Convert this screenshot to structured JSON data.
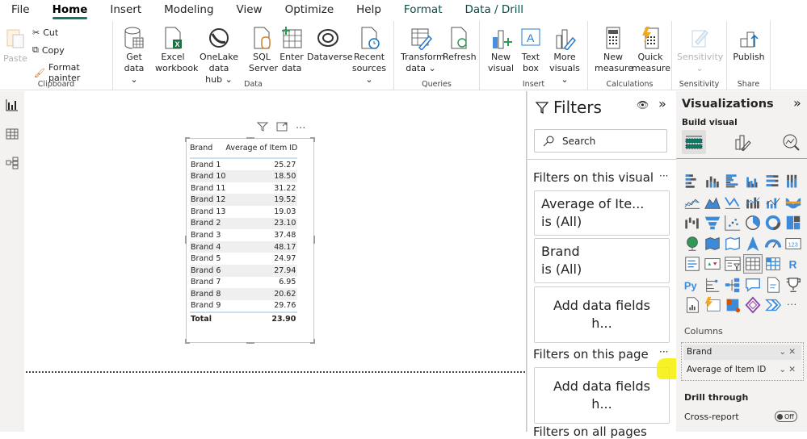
{
  "menu": {
    "tabs": [
      {
        "label": "File"
      },
      {
        "label": "Home",
        "active": true
      },
      {
        "label": "Insert"
      },
      {
        "label": "Modeling"
      },
      {
        "label": "View"
      },
      {
        "label": "Optimize"
      },
      {
        "label": "Help"
      },
      {
        "label": "Format",
        "contextual": true
      },
      {
        "label": "Data / Drill",
        "contextual": true
      }
    ]
  },
  "ribbon": {
    "clipboard": {
      "label": "Clipboard",
      "paste": "Paste",
      "cut": "Cut",
      "copy": "Copy",
      "format_painter": "Format painter"
    },
    "data": {
      "label": "Data",
      "get_data": [
        "Get",
        "data ⌄"
      ],
      "excel": [
        "Excel",
        "workbook"
      ],
      "onelake": [
        "OneLake data",
        "hub ⌄"
      ],
      "sql": [
        "SQL",
        "Server"
      ],
      "enter": [
        "Enter",
        "data"
      ],
      "dataverse": [
        "Dataverse",
        ""
      ],
      "recent": [
        "Recent",
        "sources ⌄"
      ]
    },
    "queries": {
      "label": "Queries",
      "transform": [
        "Transform",
        "data ⌄"
      ],
      "refresh": [
        "Refresh",
        ""
      ]
    },
    "insert": {
      "label": "Insert",
      "new_visual": [
        "New",
        "visual"
      ],
      "text_box": [
        "Text",
        "box"
      ],
      "more_visuals": [
        "More",
        "visuals ⌄"
      ]
    },
    "calculations": {
      "label": "Calculations",
      "new_measure": [
        "New",
        "measure"
      ],
      "quick_measure": [
        "Quick",
        "measure"
      ]
    },
    "sensitivity": {
      "label": "Sensitivity",
      "btn": [
        "Sensitivity",
        "⌄"
      ]
    },
    "share": {
      "label": "Share",
      "publish": [
        "Publish",
        ""
      ]
    }
  },
  "visual": {
    "headers": [
      "Brand",
      "Average of Item ID"
    ],
    "rows": [
      [
        "Brand 1",
        "25.27"
      ],
      [
        "Brand 10",
        "18.50"
      ],
      [
        "Brand 11",
        "31.22"
      ],
      [
        "Brand 12",
        "19.52"
      ],
      [
        "Brand 13",
        "19.03"
      ],
      [
        "Brand 2",
        "23.10"
      ],
      [
        "Brand 3",
        "37.48"
      ],
      [
        "Brand 4",
        "48.17"
      ],
      [
        "Brand 5",
        "24.97"
      ],
      [
        "Brand 6",
        "27.94"
      ],
      [
        "Brand 7",
        "6.95"
      ],
      [
        "Brand 8",
        "20.62"
      ],
      [
        "Brand 9",
        "29.76"
      ]
    ],
    "total": [
      "Total",
      "23.90"
    ]
  },
  "filters": {
    "title": "Filters",
    "search_placeholder": "Search",
    "on_visual_label": "Filters on this visual",
    "visual_cards": [
      {
        "line1": "Average of Ite...",
        "line2": "is (All)"
      },
      {
        "line1": "Brand",
        "line2": "is (All)"
      }
    ],
    "add_fields": "Add data fields h...",
    "on_page_label": "Filters on this page",
    "on_all_label": "Filters on all pages",
    "more": "···"
  },
  "visualizations": {
    "title": "Visualizations",
    "build_visual": "Build visual",
    "columns_label": "Columns",
    "wells": [
      "Brand",
      "Average of Item ID"
    ],
    "drill_through": "Drill through",
    "cross_report": "Cross-report",
    "toggle_state": "Off",
    "more": "···"
  }
}
